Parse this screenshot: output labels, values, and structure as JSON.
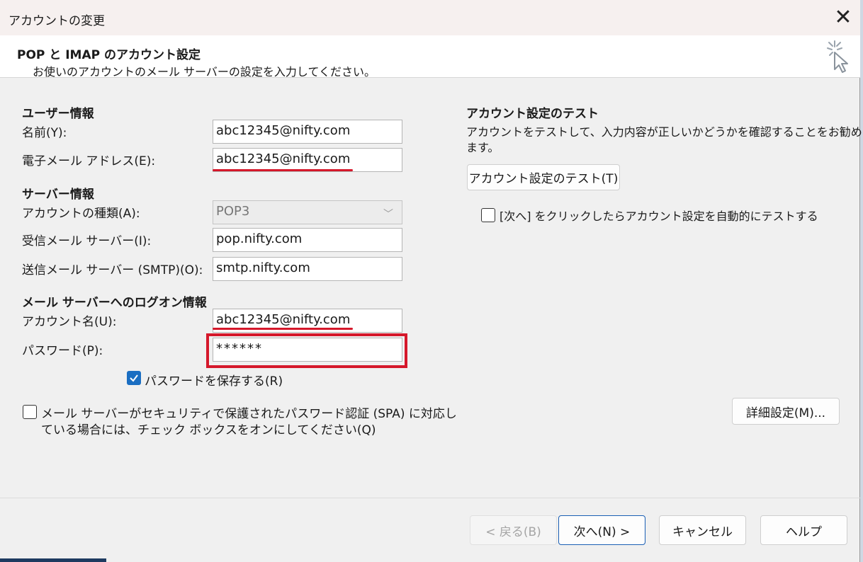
{
  "window": {
    "title": "アカウントの変更",
    "close_label": "✕"
  },
  "header": {
    "title": "POP と IMAP のアカウント設定",
    "subtitle": "お使いのアカウントのメール サーバーの設定を入力してください。"
  },
  "user_info": {
    "section": "ユーザー情報",
    "name_label": "名前(Y):",
    "name_value": "abc12345@nifty.com",
    "email_label": "電子メール アドレス(E):",
    "email_value": "abc12345@nifty.com"
  },
  "server_info": {
    "section": "サーバー情報",
    "account_type_label": "アカウントの種類(A):",
    "account_type_value": "POP3",
    "incoming_label": "受信メール サーバー(I):",
    "incoming_value": "pop.nifty.com",
    "outgoing_label": "送信メール サーバー (SMTP)(O):",
    "outgoing_value": "smtp.nifty.com"
  },
  "logon_info": {
    "section": "メール サーバーへのログオン情報",
    "account_name_label": "アカウント名(U):",
    "account_name_value": "abc12345@nifty.com",
    "password_label": "パスワード(P):",
    "password_value": "******",
    "save_password_label": "パスワードを保存する(R)"
  },
  "spa": {
    "line1": "メール サーバーがセキュリティで保護されたパスワード認証 (SPA) に対応し",
    "line2": "ている場合には、チェック ボックスをオンにしてください(Q)"
  },
  "test": {
    "section": "アカウント設定のテスト",
    "desc1": "アカウントをテストして、入力内容が正しいかどうかを確認することをお勧めし",
    "desc2": "ます。",
    "test_button": "アカウント設定のテスト(T)",
    "auto_test_label": "[次へ] をクリックしたらアカウント設定を自動的にテストする"
  },
  "advanced_button": "詳細設定(M)...",
  "footer": {
    "back": "< 戻る(B)",
    "next": "次へ(N) >",
    "cancel": "キャンセル",
    "help": "ヘルプ"
  },
  "colors": {
    "accent": "#1a6ec2",
    "highlight_red": "#d5182b"
  }
}
